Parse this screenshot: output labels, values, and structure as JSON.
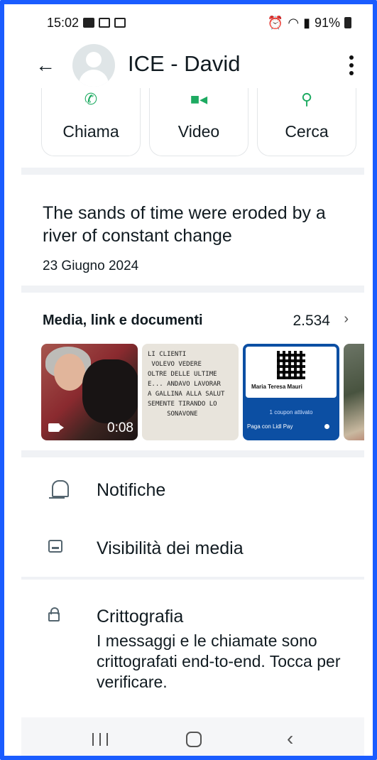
{
  "status_bar": {
    "time": "15:02",
    "battery": "91%"
  },
  "header": {
    "contact_name": "ICE - David"
  },
  "actions": [
    {
      "label": "Chiama",
      "icon": "phone-icon"
    },
    {
      "label": "Video",
      "icon": "video-icon"
    },
    {
      "label": "Cerca",
      "icon": "search-icon"
    }
  ],
  "about": {
    "text": "The sands of time were eroded by a river of constant change",
    "date": "23 Giugno 2024"
  },
  "media": {
    "title": "Media, link e documenti",
    "count": "2.534",
    "video_duration": "0:08",
    "note_text": "LI CLIENTI\n VOLEVO VEDERE\nOLTRE DELLE ULTIME\nE... ANDAVO LAVORAR\nA GALLINA ALLA SALUT\nSEMENTE TIRANDO LO\n     SONAVONE",
    "card_name": "Maria Teresa Mauri",
    "card_coupon": "1 coupon attivato",
    "card_pay": "Paga con Lidl Pay"
  },
  "settings": {
    "notifications": "Notifiche",
    "media_visibility": "Visibilità dei media",
    "encryption": "Crittografia",
    "encryption_desc": "I messaggi e le chiamate sono crittografati end-to-end. Tocca per verificare."
  },
  "colors": {
    "accent": "#1daa61",
    "frame": "#1a5cff"
  }
}
